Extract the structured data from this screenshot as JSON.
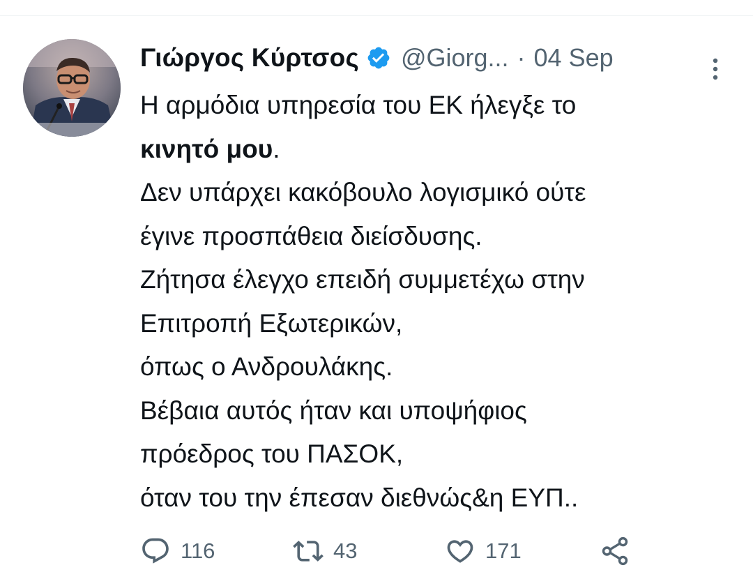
{
  "tweet": {
    "author_name": "Γιώργος Κύρτσος",
    "handle": "@Giorg...",
    "separator": "·",
    "date": "04 Sep",
    "body_line_1": "Η αρμόδια υπηρεσία του ΕΚ ήλεγξε το",
    "body_line_2_bold": "κινητό μου",
    "body_line_2_rest": ".",
    "body_line_3": "Δεν υπάρχει κακόβουλο λογισμικό ούτε",
    "body_line_4": "έγινε προσπάθεια διείσδυσης.",
    "body_line_5": "Ζήτησα έλεγχο επειδή συμμετέχω στην",
    "body_line_6": "Επιτροπή Εξωτερικών,",
    "body_line_7": "όπως ο Ανδρουλάκης.",
    "body_line_8": "Βέβαια αυτός ήταν και υποψήφιος",
    "body_line_9": "πρόεδρος του ΠΑΣΟΚ,",
    "body_line_10": "όταν του την έπεσαν διεθνώς&η ΕΥΠ.."
  },
  "actions": {
    "reply_icon": "reply-icon",
    "reply_count": "116",
    "retweet_icon": "retweet-icon",
    "retweet_count": "43",
    "like_icon": "heart-icon",
    "like_count": "171",
    "share_icon": "share-icon"
  },
  "colors": {
    "text_primary": "#0f1419",
    "text_secondary": "#536471",
    "verified_blue": "#1d9bf0",
    "divider": "#eff3f4"
  }
}
